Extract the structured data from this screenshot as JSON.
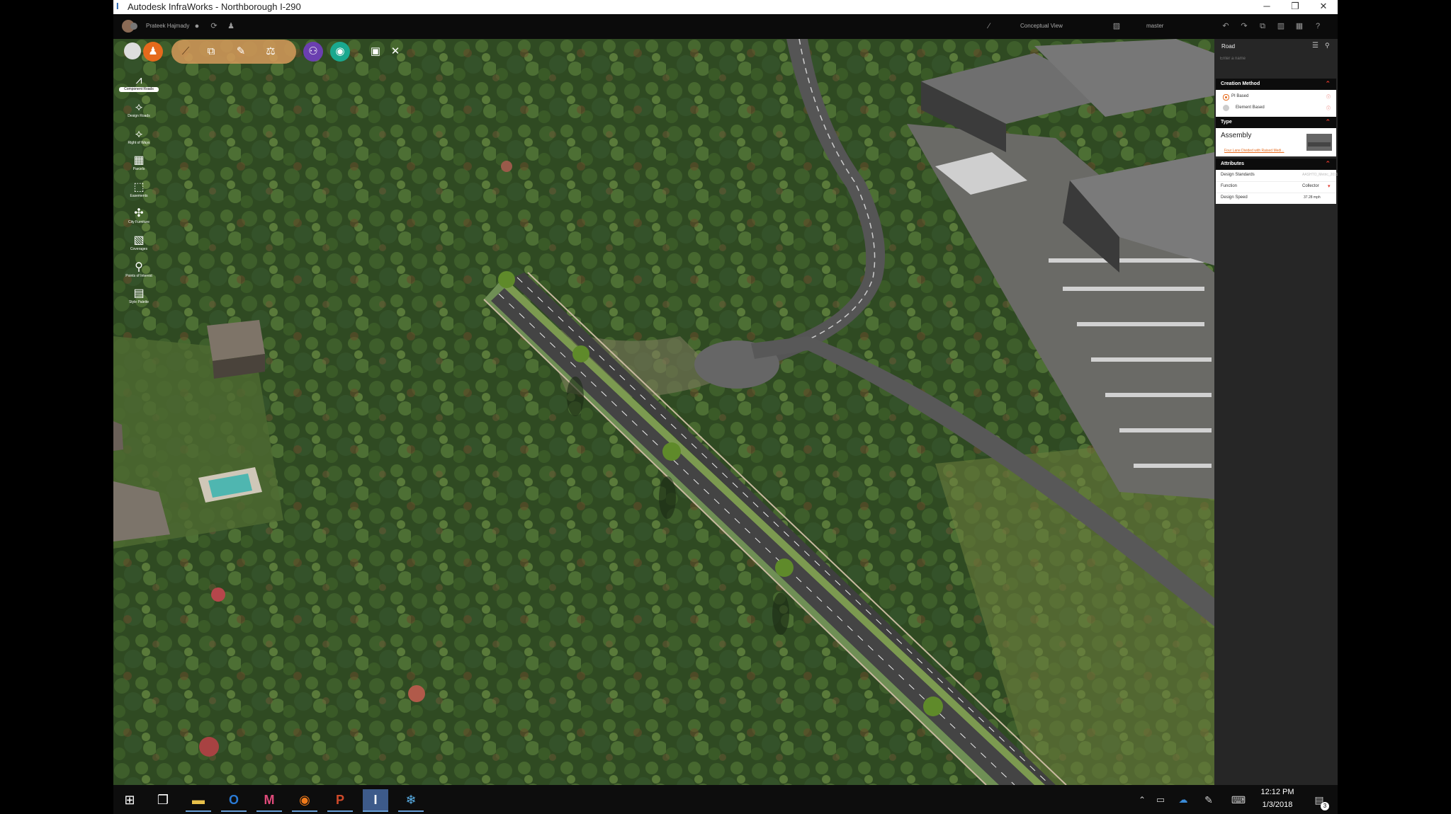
{
  "window": {
    "title": "Autodesk InfraWorks - Northborough I-290",
    "app_glyph": "I",
    "controls": {
      "minimize": "─",
      "restore": "❐",
      "close": "✕"
    }
  },
  "appbar": {
    "user_name": "Prateek Hajmady",
    "view_mode": "Conceptual View",
    "proposal": "master"
  },
  "palette": {
    "items": [
      {
        "label": "Component Roads",
        "icon": "road-icon",
        "glyph": "⩘"
      },
      {
        "label": "Design Roads",
        "icon": "design-road-icon",
        "glyph": "⟡"
      },
      {
        "label": "Right of Ways",
        "icon": "right-of-way-icon",
        "glyph": "⟡"
      },
      {
        "label": "Parcels",
        "icon": "parcel-icon",
        "glyph": "▦"
      },
      {
        "label": "Easements",
        "icon": "easement-icon",
        "glyph": "⬚"
      },
      {
        "label": "City Furniture",
        "icon": "city-furniture-icon",
        "glyph": "✣"
      },
      {
        "label": "Coverages",
        "icon": "coverage-icon",
        "glyph": "▧"
      },
      {
        "label": "Points of Interest",
        "icon": "point-of-interest-icon",
        "glyph": "⚲"
      },
      {
        "label": "Style Palette",
        "icon": "style-palette-icon",
        "glyph": "▤"
      }
    ]
  },
  "panel": {
    "title": "Road",
    "name_placeholder": "Enter a name",
    "creation_method": {
      "heading": "Creation Method",
      "options": [
        {
          "label": "PI Based",
          "selected": true
        },
        {
          "label": "Element Based",
          "selected": false
        }
      ]
    },
    "type": {
      "heading": "Type",
      "value": "Assembly",
      "assembly_link": "Four Lane Divided with Raised Medi..."
    },
    "attributes": {
      "heading": "Attributes",
      "rows": [
        {
          "label": "Design Standards",
          "value": "AASHTO_Metric_2011"
        },
        {
          "label": "Function",
          "value": "Collector"
        },
        {
          "label": "Design Speed",
          "value": "37.28 mph"
        }
      ]
    }
  },
  "taskbar": {
    "time": "12:12 PM",
    "date": "1/3/2018",
    "notification_count": "3",
    "apps": [
      {
        "name": "start-button",
        "glyph": "⊞"
      },
      {
        "name": "task-view-button",
        "glyph": "❐"
      },
      {
        "name": "file-explorer-button",
        "glyph": "▬"
      },
      {
        "name": "outlook-button",
        "glyph": "O"
      },
      {
        "name": "app-m-button",
        "glyph": "M"
      },
      {
        "name": "firefox-button",
        "glyph": "◉"
      },
      {
        "name": "powerpoint-button",
        "glyph": "P"
      },
      {
        "name": "infraworks-button",
        "glyph": "I"
      },
      {
        "name": "app-snowflake-button",
        "glyph": "❄"
      }
    ]
  },
  "colors": {
    "accent_orange": "#e56a1c",
    "accent_purple": "#6b3fb0",
    "accent_teal": "#1aa88f",
    "panel_dark": "#262626",
    "section_bar": "#0c0c0c",
    "chevron_red": "#e0372b"
  }
}
